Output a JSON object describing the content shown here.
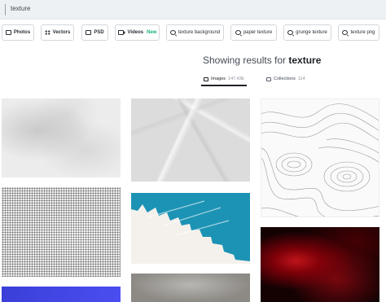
{
  "search": {
    "query": "texture"
  },
  "filters": [
    {
      "label": "Photos",
      "icon": "photo-icon"
    },
    {
      "label": "Vectors",
      "icon": "vector-icon"
    },
    {
      "label": "PSD",
      "icon": "psd-icon"
    },
    {
      "label": "Videos",
      "badge": "New",
      "icon": "video-icon"
    },
    {
      "label": "texture background",
      "icon": "search-icon"
    },
    {
      "label": "paper texture",
      "icon": "search-icon"
    },
    {
      "label": "grunge texture",
      "icon": "search-icon"
    },
    {
      "label": "texture png",
      "icon": "search-icon"
    }
  ],
  "results": {
    "prefix": "Showing results for",
    "term": "texture",
    "tabs": [
      {
        "label": "Images",
        "count": "147.43k",
        "active": true
      },
      {
        "label": "Collections",
        "count": "114",
        "active": false
      }
    ]
  },
  "colors": {
    "new_badge": "#1bb37a",
    "accent_blue": "#1c93b5"
  }
}
